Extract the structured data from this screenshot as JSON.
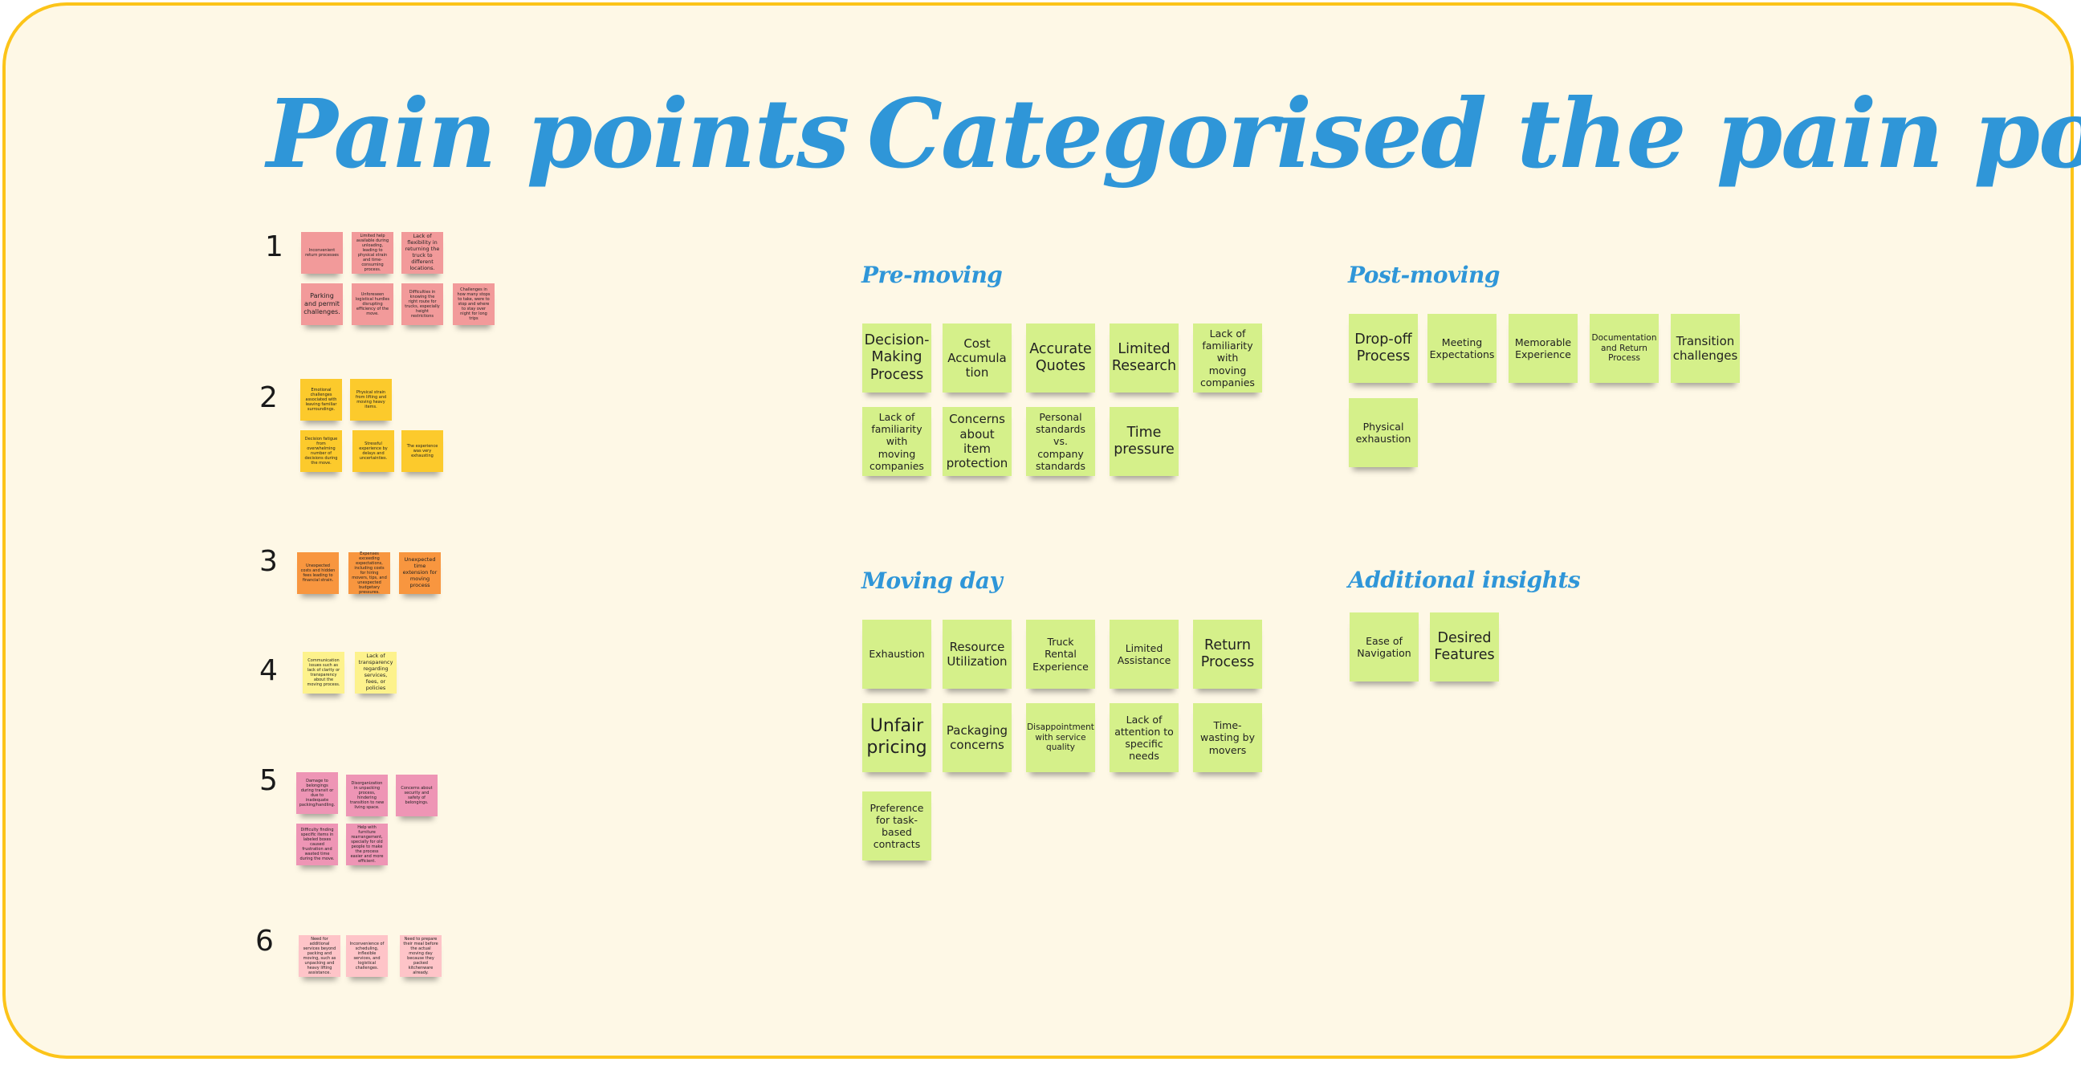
{
  "titles": {
    "pain_points": "Pain points",
    "categorised": "Categorised the pain points"
  },
  "colors": {
    "border": "#fcc419",
    "background": "#fef8e6",
    "title": "#2f96d8",
    "group1": "#f29a9a",
    "group2": "#fcca2c",
    "group3": "#f8963f",
    "group4": "#fdf28c",
    "group5": "#ee95b5",
    "group6": "#fec4c8",
    "category_note": "#d5f08a"
  },
  "groups": [
    {
      "number": "1",
      "notes": [
        "Inconvenient return processes",
        "Limited help available during unloading, leading to physical strain and time-consuming process.",
        "Lack of flexibility in returning the truck to different locations.",
        "Parking and permit challenges.",
        "Unforeseen logistical hurdles disrupting efficiency of the move.",
        "Difficulties in knowing the right route for trucks, especially height restrictions",
        "Challenges in how many stops to take, were to stop and where to stay over night for long trips"
      ]
    },
    {
      "number": "2",
      "notes": [
        "Emotional challenges associated with leaving familiar surroundings.",
        "Physical strain from lifting and moving heavy items.",
        "Decision fatigue from overwhelming number of decisions during the move.",
        "Stressful experience by delays and uncertainties.",
        "The experience was very exhausting"
      ]
    },
    {
      "number": "3",
      "notes": [
        "Unexpected costs and hidden fees leading to financial strain.",
        "Expenses exceeding expectations, including costs for hiring movers, tips, and unexpected budgetary pressures.",
        "Unexpected time extension for moving process"
      ]
    },
    {
      "number": "4",
      "notes": [
        "Communication issues such as lack of clarity or transparency about the moving process.",
        "Lack of transparency regarding services, fees, or policies"
      ]
    },
    {
      "number": "5",
      "notes": [
        "Damage to belongings during transit or due to inadequate packing/handling.",
        "Disorganization in unpacking process, hindering transition to new living space.",
        "Concerns about security and safety of belongings.",
        "Difficulty finding specific items in labeled boxes caused frustration and wasted time during the move.",
        "Help with furniture rearrangement, specially for old people to make the process easier and more efficient."
      ]
    },
    {
      "number": "6",
      "notes": [
        "Need for additional services beyond packing and moving, such as unpacking and heavy lifting assistance.",
        "Inconvenience of scheduling, inflexible services, and logistical challenges.",
        "Need to prepare their meal before the actual moving day because they packed kitchenware already."
      ]
    }
  ],
  "categories": {
    "pre_moving": {
      "title": "Pre-moving",
      "notes": [
        "Decision-Making Process",
        "Cost Accumula tion",
        "Accurate Quotes",
        "Limited Research",
        "Lack of familiarity with moving companies",
        "Lack of familiarity with moving companies",
        "Concerns about item protection",
        "Personal standards vs. company standards",
        "Time pressure"
      ]
    },
    "post_moving": {
      "title": "Post-moving",
      "notes": [
        "Drop-off Process",
        "Meeting Expectations",
        "Memorable Experience",
        "Documentation and Return Process",
        "Transition challenges",
        "Physical exhaustion"
      ]
    },
    "moving_day": {
      "title": "Moving day",
      "notes": [
        "Exhaustion",
        "Resource Utilization",
        "Truck Rental Experience",
        "Limited Assistance",
        "Return Process",
        "Unfair pricing",
        "Packaging concerns",
        "Disappointment with service quality",
        "Lack of attention to specific needs",
        "Time-wasting by movers",
        "Preference for task-based contracts"
      ]
    },
    "additional_insights": {
      "title": "Additional insights",
      "notes": [
        "Ease of Navigation",
        "Desired Features"
      ]
    }
  }
}
